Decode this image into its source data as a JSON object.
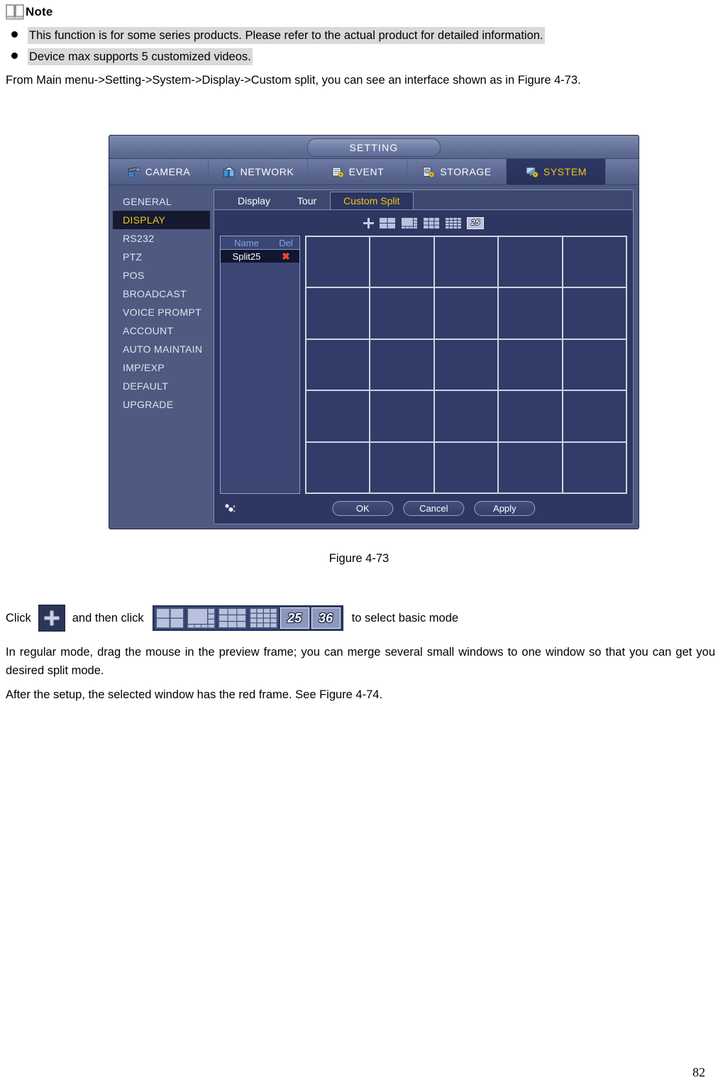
{
  "note": {
    "icon": "book-icon",
    "label": "Note",
    "bullets": [
      "This function is for some series products. Please refer to the actual product for detailed information.",
      "Device max supports 5 customized videos."
    ]
  },
  "intro_paragraph": "From Main menu->Setting->System->Display->Custom split, you can see an interface shown as in Figure 4-73.",
  "figure_caption": "Figure 4-73",
  "click_line": {
    "prefix": "Click",
    "middle": "and then click",
    "suffix": "to select basic mode",
    "plus_icon": "plus-icon",
    "mode_icons": [
      {
        "name": "split-4-icon",
        "label": ""
      },
      {
        "name": "split-6-icon",
        "label": ""
      },
      {
        "name": "split-9-icon",
        "label": ""
      },
      {
        "name": "split-16-icon",
        "label": ""
      },
      {
        "name": "split-25-icon",
        "label": "25"
      },
      {
        "name": "split-36-icon",
        "label": "36"
      }
    ]
  },
  "tail_paragraphs": [
    "In regular mode, drag the mouse in the preview frame; you can merge several small windows to one window so that you can get you desired split mode.",
    "After the setup, the selected window has the red frame. See Figure 4-74."
  ],
  "page_number": "82",
  "dvr": {
    "window_title": "SETTING",
    "top_tabs": [
      {
        "label": "CAMERA",
        "icon": "camera-icon",
        "active": false
      },
      {
        "label": "NETWORK",
        "icon": "network-icon",
        "active": false
      },
      {
        "label": "EVENT",
        "icon": "event-icon",
        "active": false
      },
      {
        "label": "STORAGE",
        "icon": "storage-icon",
        "active": false
      },
      {
        "label": "SYSTEM",
        "icon": "system-icon",
        "active": true
      }
    ],
    "sidebar": [
      {
        "label": "GENERAL",
        "active": false
      },
      {
        "label": "DISPLAY",
        "active": true
      },
      {
        "label": "RS232",
        "active": false
      },
      {
        "label": "PTZ",
        "active": false
      },
      {
        "label": "POS",
        "active": false
      },
      {
        "label": "BROADCAST",
        "active": false
      },
      {
        "label": "VOICE PROMPT",
        "active": false
      },
      {
        "label": "ACCOUNT",
        "active": false
      },
      {
        "label": "AUTO MAINTAIN",
        "active": false
      },
      {
        "label": "IMP/EXP",
        "active": false
      },
      {
        "label": "DEFAULT",
        "active": false
      },
      {
        "label": "UPGRADE",
        "active": false
      }
    ],
    "panel_tabs": [
      {
        "label": "Display",
        "active": false
      },
      {
        "label": "Tour",
        "active": false
      },
      {
        "label": "Custom Split",
        "active": true
      }
    ],
    "toolbar": {
      "add_icon": "plus-icon",
      "split_modes": [
        {
          "name": "split-4-icon",
          "label": ""
        },
        {
          "name": "split-6-icon",
          "label": ""
        },
        {
          "name": "split-9-icon",
          "label": ""
        },
        {
          "name": "split-16-icon",
          "label": ""
        },
        {
          "name": "split-25-icon",
          "label": "25"
        }
      ]
    },
    "list": {
      "headers": [
        "Name",
        "Del"
      ],
      "rows": [
        {
          "name": "Split25",
          "del": "✖"
        }
      ]
    },
    "preview_grid": {
      "rows": 5,
      "columns": 5,
      "cells": 25
    },
    "footer": {
      "mouse_icon": "mouse-cursor-icon",
      "buttons": [
        {
          "label": "OK",
          "name": "ok-button"
        },
        {
          "label": "Cancel",
          "name": "cancel-button"
        },
        {
          "label": "Apply",
          "name": "apply-button"
        }
      ]
    }
  },
  "colors": {
    "window_bg": "#4e5a80",
    "panel_bg": "#2d3761",
    "accent_yellow": "#f5c518",
    "delete_red": "#ef4a28",
    "grid_line": "#cdd4e6",
    "highlight_gray": "#d9d9d9"
  }
}
